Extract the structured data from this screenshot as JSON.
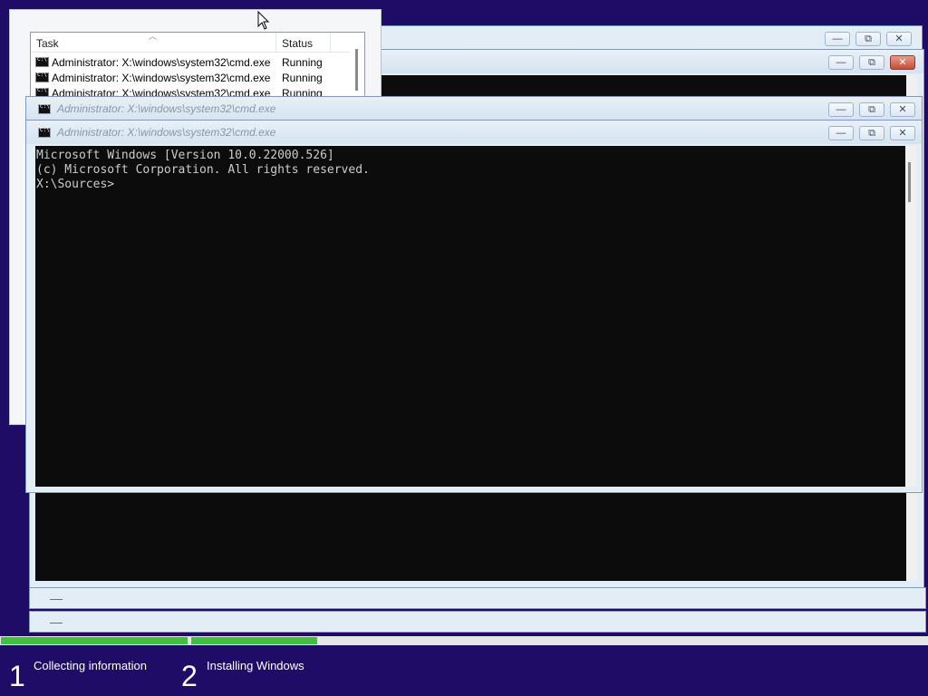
{
  "task_list": {
    "columns": [
      "Task",
      "Status"
    ],
    "rows": [
      {
        "name": "Administrator: X:\\windows\\system32\\cmd.exe",
        "status": "Running"
      },
      {
        "name": "Administrator: X:\\windows\\system32\\cmd.exe",
        "status": "Running"
      },
      {
        "name": "Administrator: X:\\windows\\system32\\cmd.exe",
        "status": "Running"
      }
    ]
  },
  "cmd_windows": {
    "back_title": "Administrator: X:\\windows\\system32\\cmd.exe",
    "front_title": "Administrator: X:\\windows\\system32\\cmd.exe"
  },
  "console": {
    "lines": [
      "Microsoft Windows [Version 10.0.22000.526]",
      "(c) Microsoft Corporation. All rights reserved.",
      "",
      "X:\\Sources>"
    ]
  },
  "window_controls": {
    "minimize_glyph": "—",
    "maximize_glyph": "⧉",
    "close_glyph": "✕"
  },
  "minimized_bars": {
    "glyph": "—"
  },
  "setup_progress": {
    "steps": [
      {
        "number": "1",
        "label": "Collecting information"
      },
      {
        "number": "2",
        "label": "Installing Windows"
      }
    ],
    "step1_fill_fraction": 1.0,
    "step2_fill_fraction": 0.17
  },
  "colors": {
    "background": "#1f0c66",
    "progress_green": "#3fbf3f",
    "console_bg": "#0c0c0c",
    "console_text": "#cccccc"
  }
}
